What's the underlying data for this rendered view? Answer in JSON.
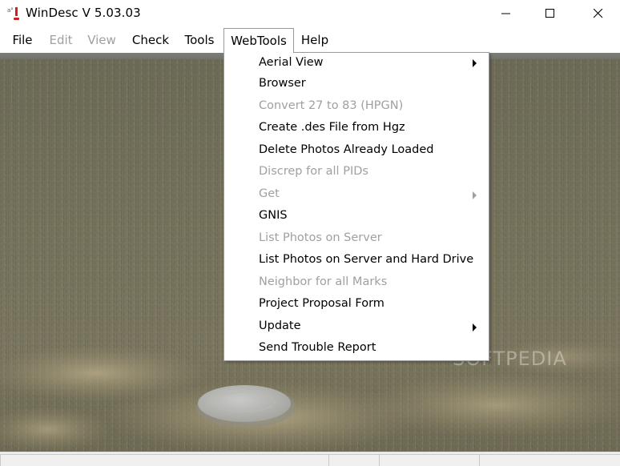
{
  "window": {
    "title": "WinDesc V 5.03.03"
  },
  "menu": {
    "items": [
      {
        "label": "File",
        "enabled": true
      },
      {
        "label": "Edit",
        "enabled": false
      },
      {
        "label": "View",
        "enabled": false
      },
      {
        "label": "Check",
        "enabled": true
      },
      {
        "label": "Tools",
        "enabled": true
      },
      {
        "label": "WebTools",
        "enabled": true,
        "open": true
      },
      {
        "label": "Help",
        "enabled": true
      }
    ]
  },
  "webtools_menu": {
    "items": [
      {
        "label": "Aerial View",
        "enabled": true,
        "submenu": true
      },
      {
        "label": "Browser",
        "enabled": true,
        "submenu": false
      },
      {
        "label": "Convert 27 to 83 (HPGN)",
        "enabled": false,
        "submenu": false
      },
      {
        "label": "Create .des File from Hgz",
        "enabled": true,
        "submenu": false
      },
      {
        "label": "Delete Photos Already Loaded",
        "enabled": true,
        "submenu": false
      },
      {
        "label": "Discrep for all PIDs",
        "enabled": false,
        "submenu": false
      },
      {
        "label": "Get",
        "enabled": false,
        "submenu": true
      },
      {
        "label": "GNIS",
        "enabled": true,
        "submenu": false
      },
      {
        "label": "List Photos on Server",
        "enabled": false,
        "submenu": false
      },
      {
        "label": "List Photos on Server and Hard Drive",
        "enabled": true,
        "submenu": false
      },
      {
        "label": "Neighbor for all Marks",
        "enabled": false,
        "submenu": false
      },
      {
        "label": "Project Proposal Form",
        "enabled": true,
        "submenu": false
      },
      {
        "label": "Update",
        "enabled": true,
        "submenu": true
      },
      {
        "label": "Send Trouble Report",
        "enabled": true,
        "submenu": false
      }
    ]
  },
  "watermark": "SOFTPEDIA",
  "icons": {
    "app": "windesc-app-icon",
    "minimize": "minimize-icon",
    "maximize": "maximize-icon",
    "close": "close-icon",
    "submenu": "submenu-arrow-icon"
  },
  "colors": {
    "disabled_text": "#a0a0a0",
    "menu_border": "#9a9a9a",
    "field_grass": "#6f6a5a",
    "benchmark_disk": "#b5b5b3"
  }
}
